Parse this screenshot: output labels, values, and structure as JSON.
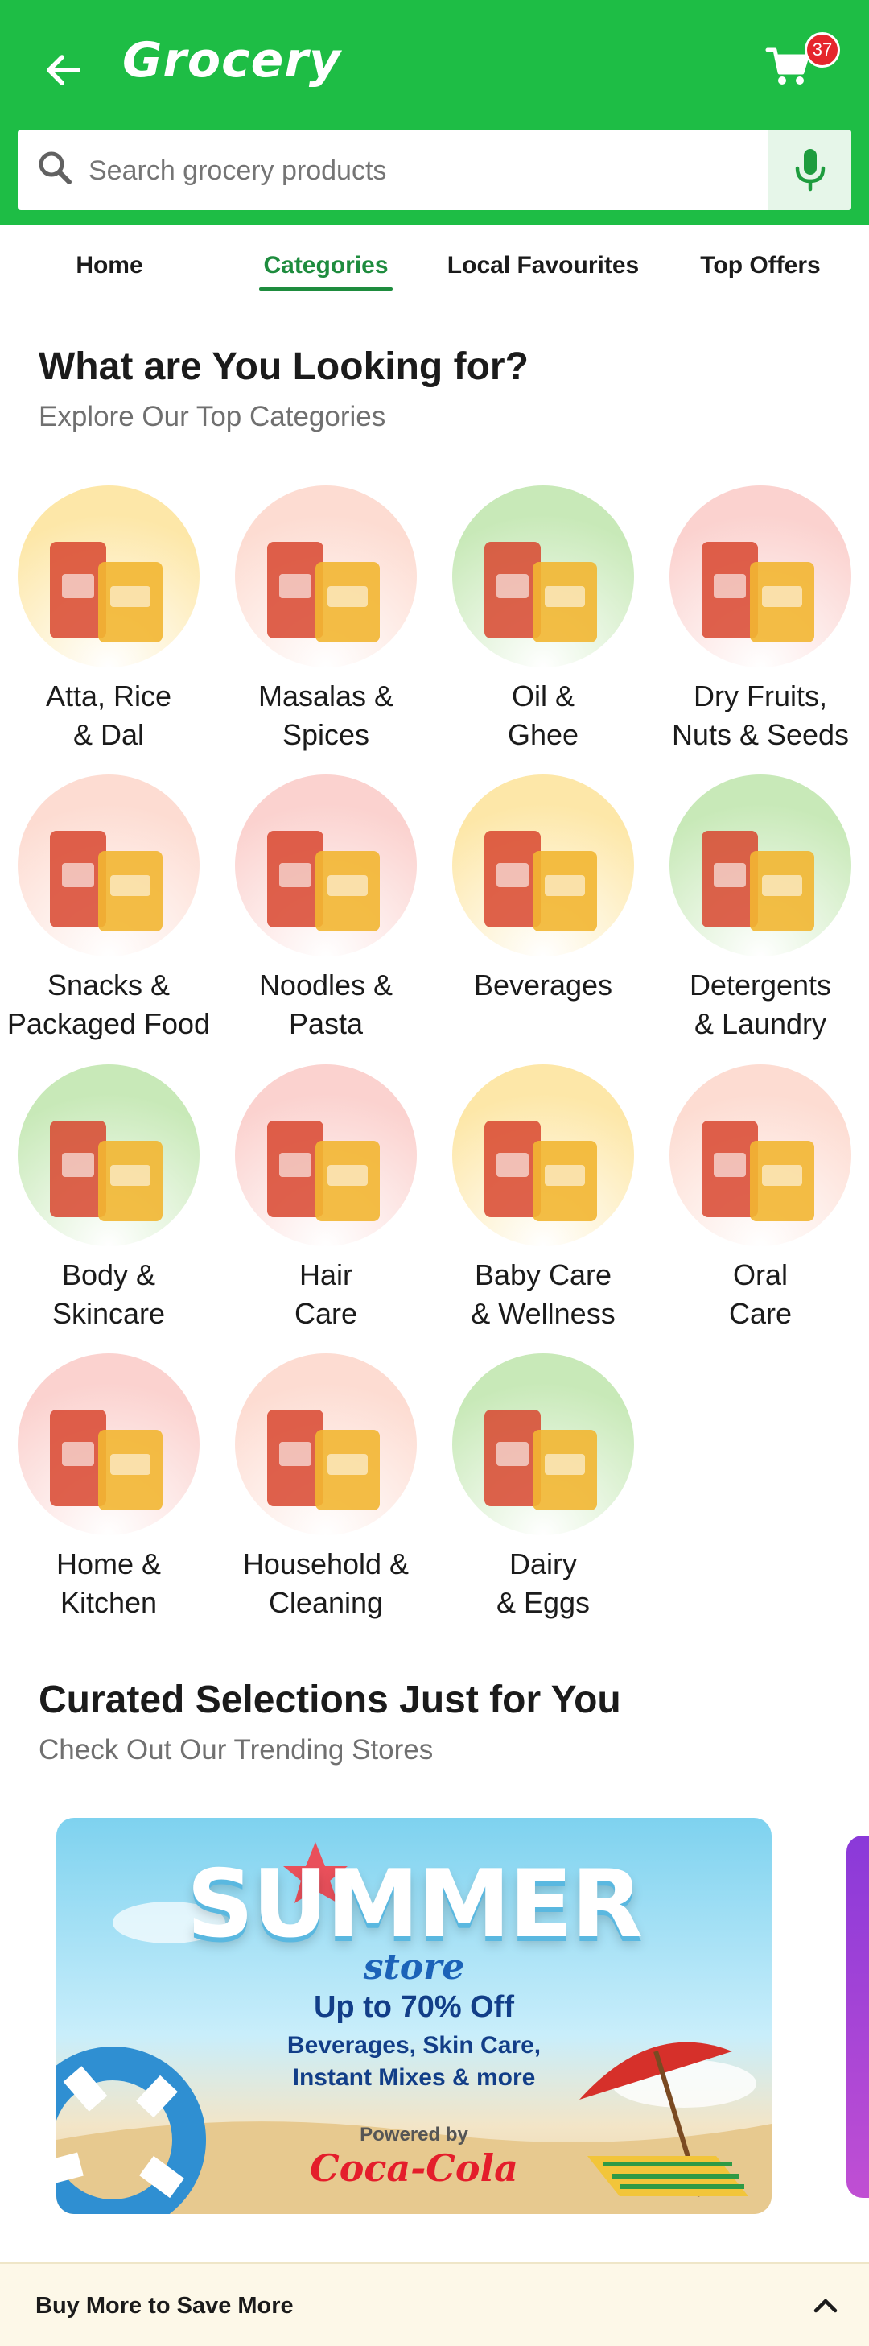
{
  "header": {
    "title": "Grocery",
    "cart_count": "37",
    "back_icon": "arrow-left-icon",
    "cart_icon": "shopping-cart-icon",
    "accent": "#1ebd45"
  },
  "search": {
    "placeholder": "Search grocery products",
    "search_icon": "search-icon",
    "mic_icon": "microphone-icon"
  },
  "tabs": [
    {
      "label": "Home",
      "active": false
    },
    {
      "label": "Categories",
      "active": true
    },
    {
      "label": "Local Favourites",
      "active": false
    },
    {
      "label": "Top Offers",
      "active": false
    }
  ],
  "categories_section": {
    "title": "What are You Looking for?",
    "subtitle": "Explore Our Top Categories",
    "items": [
      {
        "label": "Atta, Rice\n& Dal",
        "bg": "#fde7a8"
      },
      {
        "label": "Masalas &\nSpices",
        "bg": "#fddcd2"
      },
      {
        "label": "Oil &\nGhee",
        "bg": "#c8e9b8"
      },
      {
        "label": "Dry Fruits,\nNuts & Seeds",
        "bg": "#fbd2cf"
      },
      {
        "label": "Snacks &\nPackaged Food",
        "bg": "#fddcd2"
      },
      {
        "label": "Noodles &\nPasta",
        "bg": "#fbd2cf"
      },
      {
        "label": "Beverages",
        "bg": "#fde7a8"
      },
      {
        "label": "Detergents\n& Laundry",
        "bg": "#c8e9b8"
      },
      {
        "label": "Body &\nSkincare",
        "bg": "#c8e9b8"
      },
      {
        "label": "Hair\nCare",
        "bg": "#fbd2cf"
      },
      {
        "label": "Baby Care\n& Wellness",
        "bg": "#fde7a8"
      },
      {
        "label": "Oral\nCare",
        "bg": "#fddcd2"
      },
      {
        "label": "Home &\nKitchen",
        "bg": "#fbd2cf"
      },
      {
        "label": "Household &\nCleaning",
        "bg": "#fddcd2"
      },
      {
        "label": "Dairy\n& Eggs",
        "bg": "#c8e9b8"
      }
    ]
  },
  "curated_section": {
    "title": "Curated Selections Just for You",
    "subtitle": "Check Out Our Trending Stores"
  },
  "banner": {
    "headline": "SUMMER",
    "store": "store",
    "offer": "Up to 70% Off",
    "desc_line1": "Beverages, Skin Care,",
    "desc_line2": "Instant Mixes & more",
    "powered_by": "Powered by",
    "sponsor": "Coca-Cola"
  },
  "bottom_bar": {
    "label": "Buy More to Save More",
    "chevron_icon": "chevron-up-icon"
  }
}
